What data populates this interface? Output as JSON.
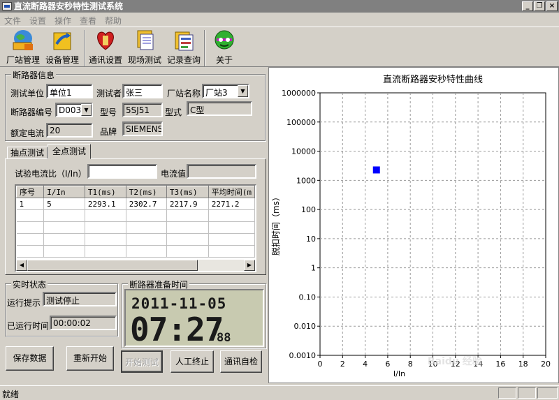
{
  "window": {
    "title": "直流断路器安秒特性测试系统",
    "min": "_",
    "restore": "❐",
    "close": "×"
  },
  "menu": [
    "文件",
    "设置",
    "操作",
    "查看",
    "帮助"
  ],
  "toolbar": [
    {
      "label": "厂站管理",
      "icon": "station-icon"
    },
    {
      "label": "设备管理",
      "icon": "device-icon"
    },
    {
      "label": "通讯设置",
      "icon": "comm-icon"
    },
    {
      "label": "现场测试",
      "icon": "test-icon"
    },
    {
      "label": "记录查询",
      "icon": "records-icon"
    },
    {
      "label": "关于",
      "icon": "about-icon"
    }
  ],
  "breaker": {
    "group_title": "断路器信息",
    "unit_label": "测试单位",
    "unit_value": "单位1",
    "tester_label": "测试者",
    "tester_value": "张三",
    "station_label": "厂站名称",
    "station_value": "厂站3",
    "id_label": "断路器编号",
    "id_value": "D003",
    "model_label": "型号",
    "model_value": "5SJ51",
    "type_label": "型式",
    "type_value": "C型",
    "current_label": "额定电流",
    "current_value": "20",
    "brand_label": "品牌",
    "brand_value": "SIEMENS"
  },
  "tabs": [
    "抽点测试",
    "全点测试"
  ],
  "test": {
    "ratio_label": "试验电流比（I/In）",
    "ratio_value": "",
    "current_label": "电流值",
    "current_value": "",
    "columns": [
      "序号",
      "I/In",
      "T1(ms)",
      "T2(ms)",
      "T3(ms)",
      "平均时间(m"
    ],
    "rows": [
      [
        "1",
        "5",
        "2293.1",
        "2302.7",
        "2217.9",
        "2271.2"
      ]
    ]
  },
  "realtime": {
    "group_title": "实时状态",
    "hint_label": "运行提示",
    "hint_value": "测试停止",
    "elapsed_label": "已运行时间",
    "elapsed_value": "00:00:02"
  },
  "prep": {
    "group_title": "断路器准备时间",
    "date": "2011-11-05",
    "time": "07:27",
    "seconds": "88"
  },
  "buttons": {
    "save": "保存数据",
    "restart": "重新开始",
    "start": "开始测试",
    "stop": "人工终止",
    "selfcheck": "通讯自检"
  },
  "status": {
    "text": "就绪"
  },
  "chart_data": {
    "type": "scatter",
    "title": "直流断路器安秒特性曲线",
    "xlabel": "I/In",
    "ylabel": "脱扣时间（ms）",
    "xlim": [
      0,
      20
    ],
    "xticks": [
      "0",
      "2",
      "4",
      "6",
      "8",
      "10",
      "12",
      "14",
      "16",
      "18",
      "20"
    ],
    "y_scale": "log",
    "ylim": [
      0.001,
      1000000
    ],
    "yticks": [
      "1000000",
      "100000",
      "10000",
      "1000",
      "100",
      "10",
      "1",
      "0.10",
      "0.010",
      "0.0010"
    ],
    "grid": true,
    "point_color": "#0000ff",
    "points": [
      {
        "x": 5,
        "y": 2271.2
      }
    ]
  }
}
